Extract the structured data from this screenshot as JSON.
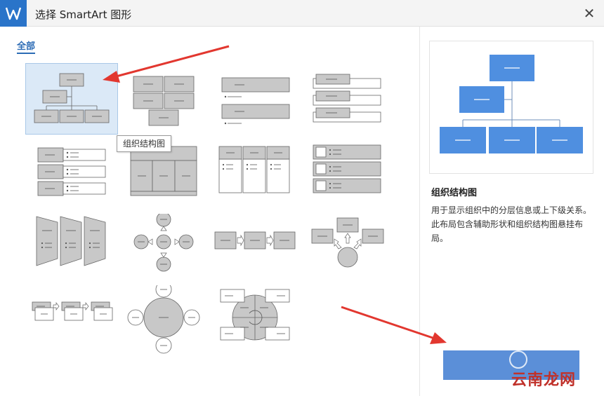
{
  "window": {
    "title": "选择 SmartArt 图形",
    "close_label": "✕"
  },
  "sidebar": {
    "category": "全部"
  },
  "tooltip": {
    "text": "组织结构图"
  },
  "preview": {
    "name": "组织结构图",
    "description": "用于显示组织中的分层信息或上下级关系。此布局包含辅助形状和组织结构图悬挂布局。"
  },
  "footer": {
    "ok_label": ""
  },
  "watermark": {
    "text": "云南龙网"
  },
  "colors": {
    "accent": "#2b6bb5",
    "preview_shape": "#4f8fe0",
    "thumb_shape": "#c8c8c8",
    "arrow": "#e2372f",
    "selected_bg": "#dbe9f7"
  }
}
